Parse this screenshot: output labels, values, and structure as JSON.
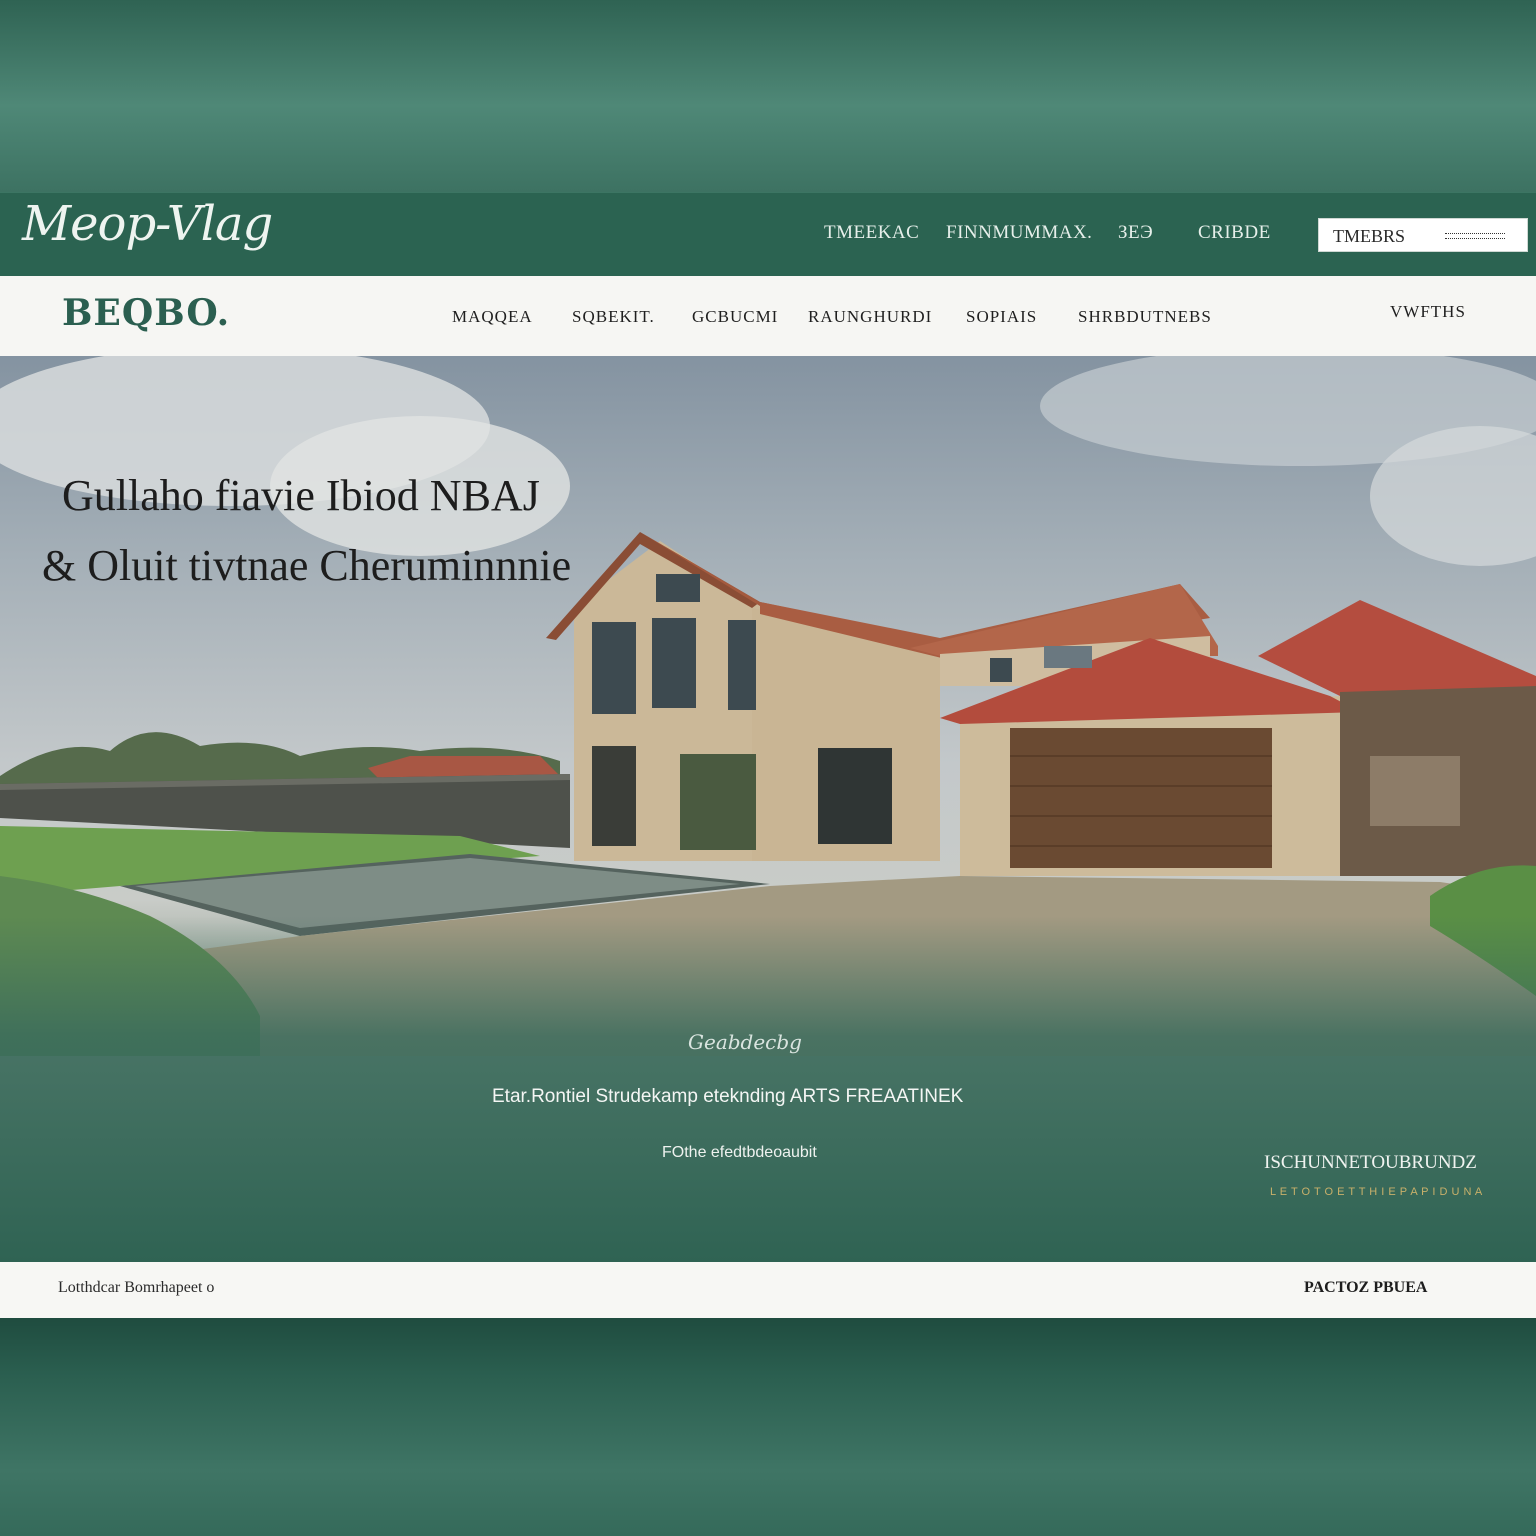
{
  "brand": {
    "logo_text": "Meop-Vlag",
    "sub_logo_text": "BEQBO."
  },
  "top_nav": [
    "TMEEKAC",
    "FINNMUMMAX.",
    "ЗЕЭ",
    "CRIBDE"
  ],
  "search": {
    "value": "TMEBRS"
  },
  "main_nav": [
    "MAQQEA",
    "SQBEKIT.",
    "GCBUCMI",
    "RAUNGHURDI",
    "SOPIAIS",
    "SHRBDUTNEBS"
  ],
  "main_nav_right": "VWFTHS",
  "hero": {
    "headline_line1": "Gullaho fiavie Ibiod NBAJ",
    "headline_line2": "& Oluit tivtnae Cheruminnnie",
    "tag": "Geabdecbg",
    "lead": "Etar.Rontiel Strudekamp eteknding  ARTS FREAATINEK",
    "sub": "FOthe efedtbdeoaubit",
    "promo_title": "ISCHUNNETOUBRUNDZ",
    "promo_note": "L E T O  T O E T  T H I E  P A P I D U N A"
  },
  "footer": {
    "left_text": "Lotthdcar Bomrhapeet o",
    "right_link": "PACTOZ PBUEA"
  },
  "colors": {
    "brand_green": "#2b6351",
    "accent_gold": "#c8b06a",
    "roof_red": "#b04a3a"
  }
}
